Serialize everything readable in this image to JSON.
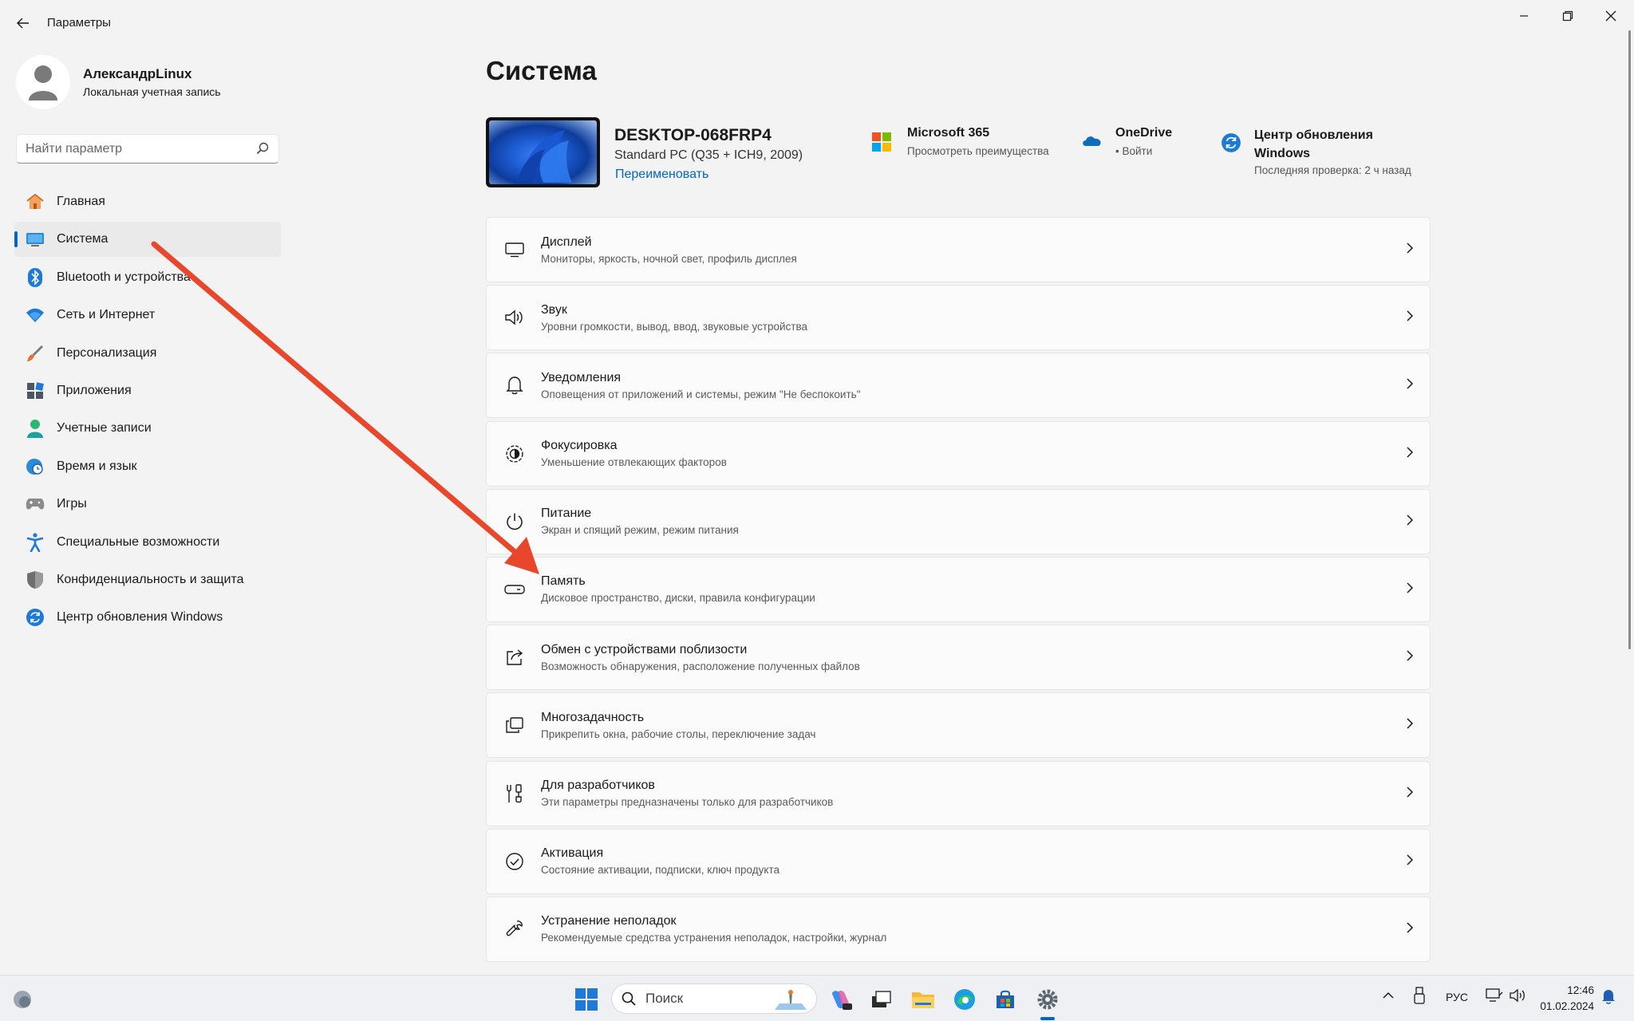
{
  "window": {
    "title": "Параметры"
  },
  "profile": {
    "name": "АлександрLinux",
    "account_type": "Локальная учетная запись"
  },
  "search": {
    "placeholder": "Найти параметр"
  },
  "nav": {
    "items": [
      {
        "label": "Главная",
        "icon": "home-icon",
        "active": false
      },
      {
        "label": "Система",
        "icon": "system-display-icon",
        "active": true
      },
      {
        "label": "Bluetooth и устройства",
        "icon": "bluetooth-icon",
        "active": false
      },
      {
        "label": "Сеть и Интернет",
        "icon": "wifi-icon",
        "active": false
      },
      {
        "label": "Персонализация",
        "icon": "brush-icon",
        "active": false
      },
      {
        "label": "Приложения",
        "icon": "apps-icon",
        "active": false
      },
      {
        "label": "Учетные записи",
        "icon": "person-icon",
        "active": false
      },
      {
        "label": "Время и язык",
        "icon": "globe-clock-icon",
        "active": false
      },
      {
        "label": "Игры",
        "icon": "gamepad-icon",
        "active": false
      },
      {
        "label": "Специальные возможности",
        "icon": "accessibility-icon",
        "active": false
      },
      {
        "label": "Конфиденциальность и защита",
        "icon": "shield-icon",
        "active": false
      },
      {
        "label": "Центр обновления Windows",
        "icon": "update-icon",
        "active": false
      }
    ]
  },
  "main": {
    "title": "Система",
    "device": {
      "name": "DESKTOP-068FRP4",
      "model": "Standard PC (Q35 + ICH9, 2009)",
      "rename_label": "Переименовать"
    },
    "tiles": [
      {
        "title": "Microsoft 365",
        "subtitle": "Просмотреть преимущества",
        "icon": "microsoft-logo-icon"
      },
      {
        "title": "OneDrive",
        "subtitle": "• Войти",
        "icon": "onedrive-cloud-icon"
      },
      {
        "title": "Центр обновления Windows",
        "subtitle": "Последняя проверка: 2 ч назад",
        "icon": "update-icon"
      }
    ],
    "cards": [
      {
        "title": "Дисплей",
        "desc": "Мониторы, яркость, ночной свет, профиль дисплея",
        "icon": "monitor-icon"
      },
      {
        "title": "Звук",
        "desc": "Уровни громкости, вывод, ввод, звуковые устройства",
        "icon": "speaker-icon"
      },
      {
        "title": "Уведомления",
        "desc": "Оповещения от приложений и системы, режим \"Не беспокоить\"",
        "icon": "bell-icon"
      },
      {
        "title": "Фокусировка",
        "desc": "Уменьшение отвлекающих факторов",
        "icon": "focus-icon"
      },
      {
        "title": "Питание",
        "desc": "Экран и спящий режим, режим питания",
        "icon": "power-icon"
      },
      {
        "title": "Память",
        "desc": "Дисковое пространство, диски, правила конфигурации",
        "icon": "storage-drive-icon"
      },
      {
        "title": "Обмен с устройствами поблизости",
        "desc": "Возможность обнаружения, расположение полученных файлов",
        "icon": "share-icon"
      },
      {
        "title": "Многозадачность",
        "desc": "Прикрепить окна, рабочие столы, переключение задач",
        "icon": "multitask-icon"
      },
      {
        "title": "Для разработчиков",
        "desc": "Эти параметры предназначены только для разработчиков",
        "icon": "developer-tools-icon"
      },
      {
        "title": "Активация",
        "desc": "Состояние активации, подписки, ключ продукта",
        "icon": "check-circle-icon"
      },
      {
        "title": "Устранение неполадок",
        "desc": "Рекомендуемые средства устранения неполадок, настройки, журнал",
        "icon": "wrench-icon"
      }
    ]
  },
  "taskbar": {
    "search_label": "Поиск",
    "language": "РУС",
    "time": "12:46",
    "date": "01.02.2024"
  },
  "colors": {
    "accent": "#0067c0",
    "annotation_arrow": "#e8472c",
    "background": "#f3f3f3"
  }
}
